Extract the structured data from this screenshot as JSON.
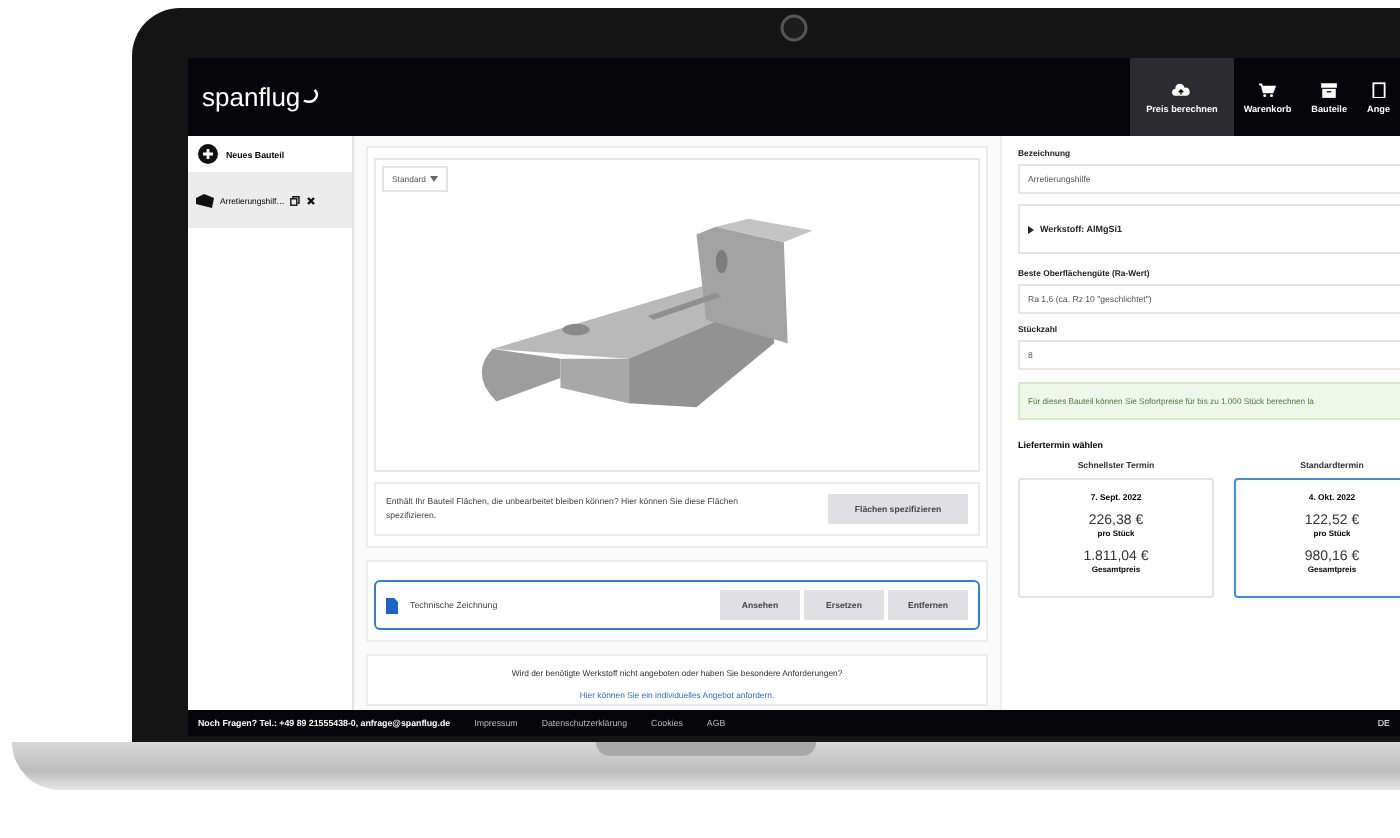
{
  "header": {
    "logo": "spanflug",
    "nav": [
      {
        "label": "Preis berechnen",
        "selected": true
      },
      {
        "label": "Warenkorb",
        "selected": false
      },
      {
        "label": "Bauteile",
        "selected": false
      },
      {
        "label": "Ange",
        "selected": false
      }
    ]
  },
  "sidebar": {
    "new_part": "Neues Bauteil",
    "parts": [
      {
        "name": "Arretierungshilf…",
        "selected": true
      }
    ]
  },
  "viewer": {
    "view_select": "Standard"
  },
  "surfaces": {
    "text": "Enthält Ihr Bauteil Flächen, die unbearbeitet bleiben können? Hier können Sie diese Flächen spezifizieren.",
    "button": "Flächen spezifizieren"
  },
  "drawing": {
    "label": "Technische Zeichnung",
    "buttons": [
      "Ansehen",
      "Ersetzen",
      "Entfernen"
    ]
  },
  "custom_offer": {
    "text": "Wird der benötigte Werkstoff nicht angeboten oder haben Sie besondere Anforderungen?",
    "link": "Hier können Sie ein individuelles Angebot anfordern."
  },
  "form": {
    "name_label": "Bezeichnung",
    "name_value": "Arretierungshilfe",
    "material": "Werkstoff: AlMgSi1",
    "surface_label": "Beste Oberflächengüte (Ra-Wert)",
    "surface_value": "Ra 1,6 (ca. Rz 10 \"geschlichtet\")",
    "quantity_label": "Stückzahl",
    "quantity_value": "8",
    "notice": "Für dieses Bauteil können Sie Sofortpreise für bis zu 1.000 Stück berechnen la"
  },
  "delivery": {
    "title": "Liefertermin wählen",
    "options": [
      {
        "heading": "Schnellster Termin",
        "date": "7. Sept. 2022",
        "unit_price": "226,38 €",
        "unit_label": "pro Stück",
        "total": "1.811,04 €",
        "total_label": "Gesamtpreis",
        "selected": false
      },
      {
        "heading": "Standardtermin",
        "date": "4. Okt. 2022",
        "unit_price": "122,52 €",
        "unit_label": "pro Stück",
        "total": "980,16 €",
        "total_label": "Gesamtpreis",
        "selected": true
      }
    ]
  },
  "footer": {
    "contact": "Noch Fragen? Tel.: +49 89 21555438-0, anfrage@spanflug.de",
    "links": [
      "Impressum",
      "Datenschutzerklärung",
      "Cookies",
      "AGB"
    ],
    "language": "DE"
  }
}
